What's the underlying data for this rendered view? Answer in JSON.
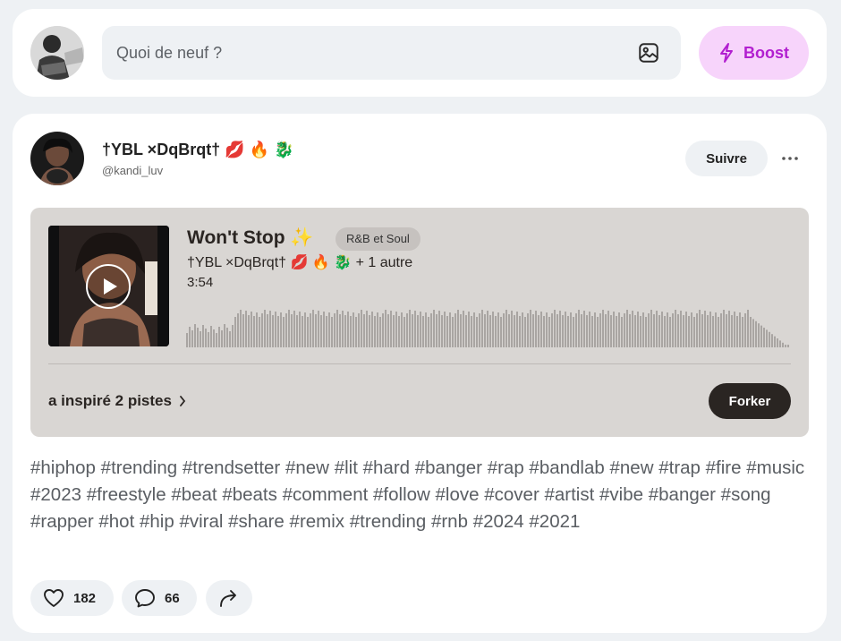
{
  "composer": {
    "placeholder": "Quoi de neuf ?",
    "boost_label": "Boost"
  },
  "post": {
    "author_name": "†YBL ×DqBrqt† 💋 🔥 🐉",
    "author_handle": "@kandi_luv",
    "follow_label": "Suivre",
    "track": {
      "title": "Won't Stop ✨",
      "genre": "R&B et Soul",
      "artists": "†YBL ×DqBrqt† 💋 🔥 🐉  + 1 autre",
      "duration": "3:54",
      "inspired": "a inspiré 2 pistes",
      "fork_label": "Forker"
    },
    "hashtags": [
      "#hiphop",
      "#trending",
      "#trendsetter",
      "#new",
      "#lit",
      "#hard",
      "#banger",
      "#rap",
      "#bandlab",
      "#new",
      "#trap",
      "#fire",
      "#music",
      "#2023",
      "#freestyle",
      "#beat",
      "#beats",
      "#comment",
      "#follow",
      "#love",
      "#cover",
      "#artist",
      "#vibe",
      "#banger",
      "#song",
      "#rapper",
      "#hot",
      "#hip",
      "#viral",
      "#share",
      "#remix",
      "#trending",
      "#rnb",
      "#2024",
      "#2021"
    ],
    "likes": "182",
    "comments": "66"
  },
  "colors": {
    "background": "#eef1f4",
    "boost_bg": "#f7d4fb",
    "boost_text": "#b21fd0",
    "track_bg": "#d9d6d3",
    "fork_bg": "#2a2522",
    "hashtag_text": "#5a5e63"
  },
  "icons": {
    "image": "image-icon",
    "boost": "lightning-icon",
    "more": "more-dots-icon",
    "play": "play-icon",
    "chevron": "chevron-right-icon",
    "like": "heart-icon",
    "comment": "comment-icon",
    "share": "share-arrow-icon"
  }
}
